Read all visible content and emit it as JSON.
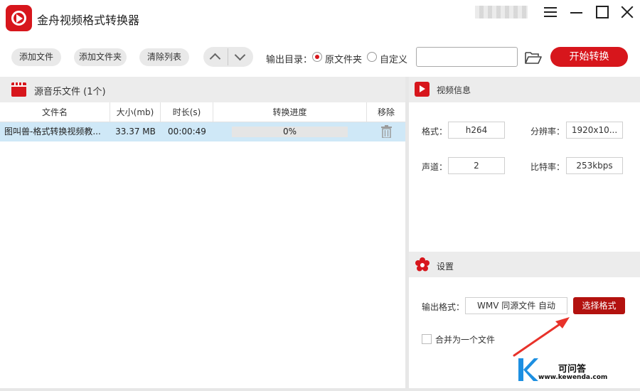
{
  "app": {
    "title": "金舟视频格式转换器"
  },
  "toolbar": {
    "add_file": "添加文件",
    "add_folder": "添加文件夹",
    "clear_list": "清除列表",
    "output_dir_label": "输出目录：",
    "radio_source_folder": "原文件夹",
    "radio_custom": "自定义",
    "selected_output": "原文件夹",
    "path_value": "",
    "start": "开始转换"
  },
  "file_panel": {
    "header": "源音乐文件 (1个)",
    "columns": [
      "文件名",
      "大小(mb)",
      "时长(s)",
      "转换进度",
      "移除"
    ],
    "rows": [
      {
        "name": "图叫兽-格式转换视频教...",
        "size": "33.37 MB",
        "duration": "00:00:49",
        "progress": "0%",
        "progress_value": 0
      }
    ]
  },
  "video_info": {
    "header": "视频信息",
    "format_label": "格式：",
    "format_value": "h264",
    "resolution_label": "分辨率：",
    "resolution_value": "1920x10...",
    "channel_label": "声道：",
    "channel_value": "2",
    "bitrate_label": "比特率：",
    "bitrate_value": "253kbps"
  },
  "settings": {
    "header": "设置",
    "output_format_label": "输出格式：",
    "output_format_value": "WMV 同源文件 自动",
    "choose_format": "选择格式",
    "merge_label": "合并为一个文件",
    "merge_checked": false
  },
  "watermark": {
    "name": "可问答",
    "url": "www.kewenda.com"
  },
  "colors": {
    "accent": "#d7161c",
    "choose_button": "#b3120f",
    "selected_row": "#cfe8f7",
    "annotation_arrow": "#e8322a"
  }
}
